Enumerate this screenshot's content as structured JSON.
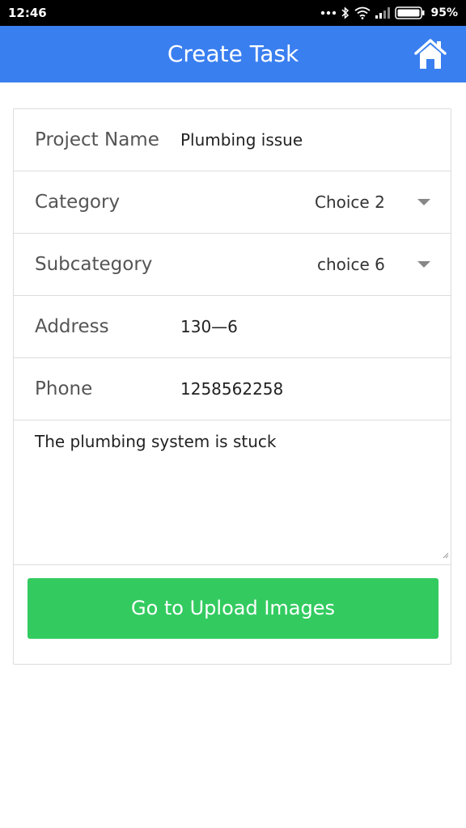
{
  "status_bar": {
    "time": "12:46",
    "battery_percent": "95%",
    "icons": [
      "more-dots-icon",
      "bluetooth-icon",
      "wifi-icon",
      "signal-icon",
      "battery-icon"
    ]
  },
  "app_bar": {
    "title": "Create Task",
    "home_icon": "home-icon",
    "color": "#3a7ff0"
  },
  "form": {
    "project_name": {
      "label": "Project Name",
      "value": "Plumbing issue"
    },
    "category": {
      "label": "Category",
      "selected": "Choice 2"
    },
    "subcategory": {
      "label": "Subcategory",
      "selected": "choice 6"
    },
    "address": {
      "label": "Address",
      "value": "130—6"
    },
    "phone": {
      "label": "Phone",
      "value": "1258562258"
    },
    "description": {
      "value": "The plumbing system is stuck"
    }
  },
  "upload_button": {
    "label": "Go to Upload Images",
    "color": "#33cb60"
  }
}
